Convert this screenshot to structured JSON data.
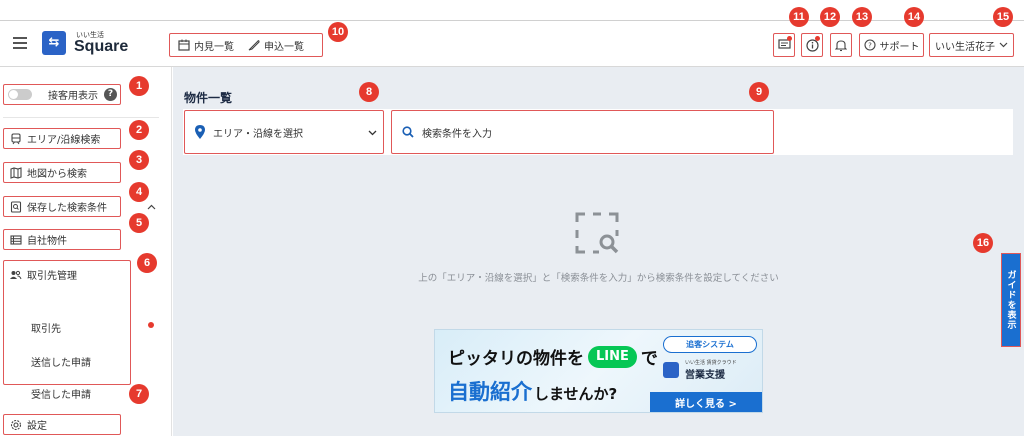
{
  "header": {
    "brand_small": "いい生活",
    "brand": "Square",
    "logo_glyph": "⇆",
    "quick_links": [
      {
        "label": "内見一覧",
        "icon": "calendar-icon"
      },
      {
        "label": "申込一覧",
        "icon": "quill-icon"
      }
    ],
    "support_label": "サポート",
    "user_name": "いい生活花子"
  },
  "sidebar": {
    "toggle_label": "接客用表示",
    "items": [
      {
        "label": "エリア/沿線検索",
        "icon": "train-icon"
      },
      {
        "label": "地図から検索",
        "icon": "map-icon"
      },
      {
        "label": "保存した検索条件",
        "icon": "saved-search-icon"
      },
      {
        "label": "自社物件",
        "icon": "list-icon"
      },
      {
        "label": "取引先管理",
        "icon": "people-icon"
      }
    ],
    "sub_items": [
      "取引先",
      "送信した申請",
      "受信した申請"
    ],
    "settings_label": "設定"
  },
  "main": {
    "title": "物件一覧",
    "area_select": "エリア・沿線を選択",
    "search_placeholder": "検索条件を入力",
    "empty_message": "上の「エリア・沿線を選択」と「検索条件を入力」から検索条件を設定してください"
  },
  "banner": {
    "line1_a": "ピッタリの物件を",
    "line1_line": "LINE",
    "line1_b": "で",
    "line2_big": "自動紹介",
    "line2_rest": "しませんか?",
    "system_label": "追客システム",
    "brand_small": "いい生活 賃貸クラウド",
    "brand_name": "営業支援",
    "cta": "詳しく見る >"
  },
  "guide_tab": "ガイドを表示",
  "annotations": [
    "1",
    "2",
    "3",
    "4",
    "5",
    "6",
    "7",
    "8",
    "9",
    "10",
    "11",
    "12",
    "13",
    "14",
    "15",
    "16"
  ],
  "colors": {
    "accent_blue": "#1a6fd0",
    "badge_red": "#e63a2e",
    "line_green": "#06c755",
    "main_bg": "#e9edf2"
  }
}
